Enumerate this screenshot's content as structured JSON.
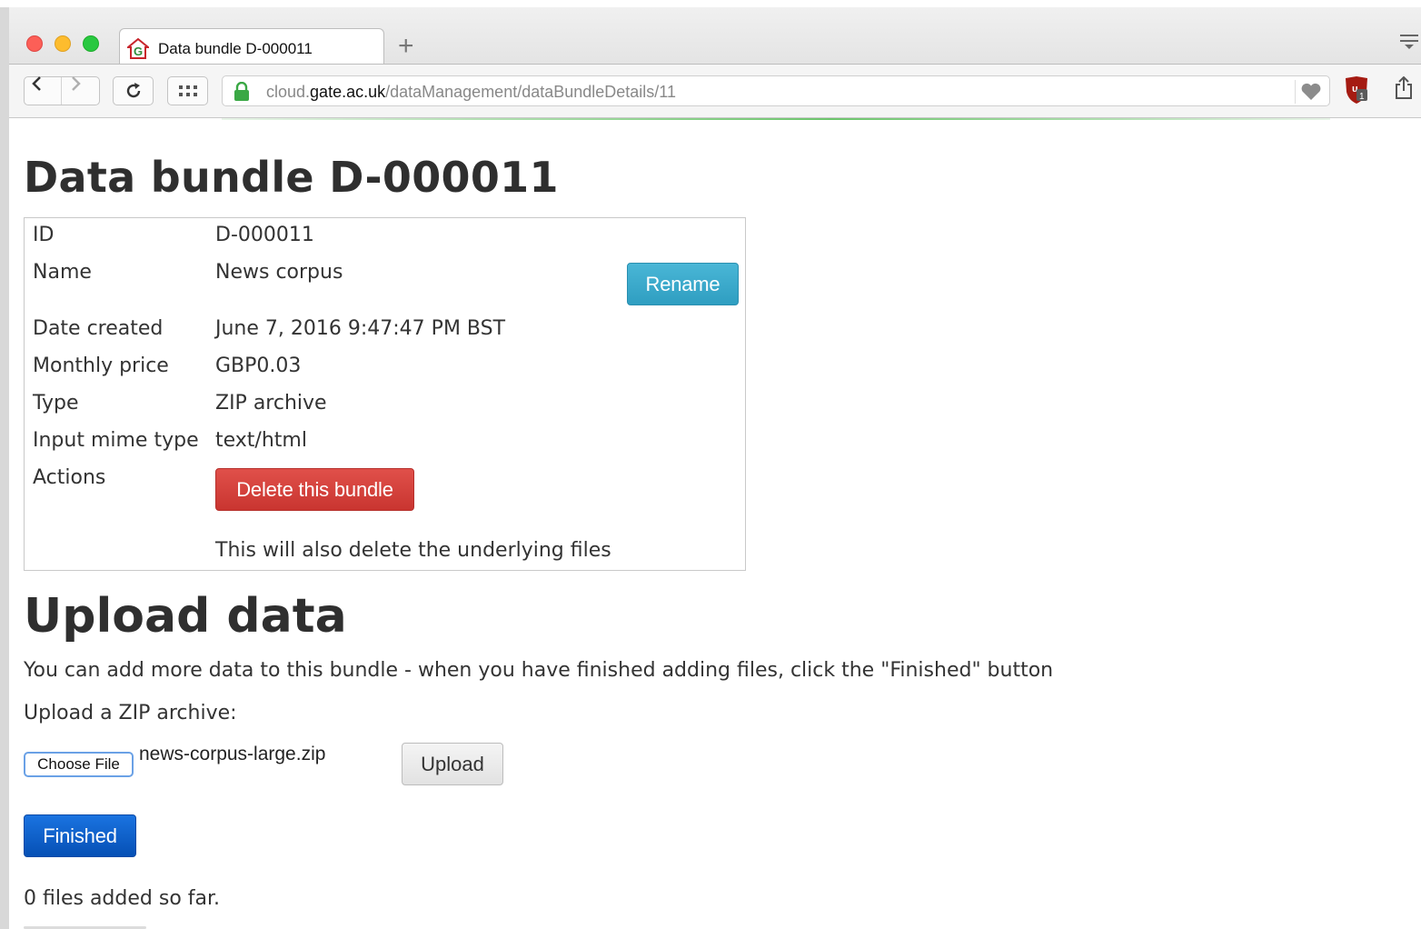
{
  "browser": {
    "tab_title": "Data bundle D-000011",
    "new_tab_symbol": "+",
    "url_prefix": "cloud.",
    "url_domain": "gate.ac.uk",
    "url_path": "/dataManagement/dataBundleDetails/11",
    "icons": [
      "back-icon",
      "forward-icon",
      "reload-icon",
      "apps-grid-icon",
      "lock-icon",
      "heart-icon",
      "extension-shield-icon",
      "share-icon",
      "menu-icon"
    ],
    "colors": {
      "lock": "#3aa845",
      "load_bar": "#6cc56c"
    }
  },
  "bundle": {
    "heading": "Data bundle D-000011",
    "fields": [
      {
        "label": "ID",
        "value": "D-000011"
      },
      {
        "label": "Name",
        "value": "News corpus"
      },
      {
        "label": "Date created",
        "value": "June 7, 2016 9:47:47 PM BST"
      },
      {
        "label": "Monthly price",
        "value": "GBP0.03"
      },
      {
        "label": "Type",
        "value": "ZIP archive"
      },
      {
        "label": "Input mime type",
        "value": "text/html"
      },
      {
        "label": "Actions",
        "value": ""
      }
    ],
    "rename_label": "Rename",
    "delete_label": "Delete this bundle",
    "delete_note": "This will also delete the underlying files",
    "colors": {
      "rename": "#31a3c7",
      "delete": "#d2403b"
    }
  },
  "upload": {
    "heading": "Upload data",
    "intro": "You can add more data to this bundle - when you have finished adding files, click the \"Finished\" button",
    "label": "Upload a ZIP archive:",
    "choose_file_label": "Choose File",
    "selected_file": "news-corpus-large.zip",
    "upload_label": "Upload",
    "finished_label": "Finished",
    "files_count_text": "0 files added so far.",
    "colors": {
      "finished": "#0b5fcc"
    }
  }
}
